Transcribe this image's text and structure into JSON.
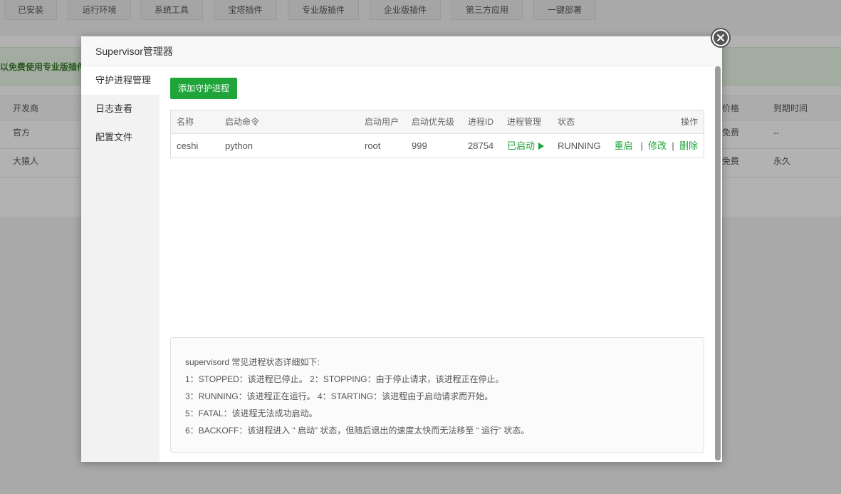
{
  "background": {
    "tabs": [
      "已安装",
      "运行环境",
      "系统工具",
      "宝塔插件",
      "专业版插件",
      "企业版插件",
      "第三方应用",
      "一键部署"
    ],
    "notice": "以免费使用专业版插件",
    "table_headers": {
      "developer": "开发商",
      "price": "价格",
      "expire": "到期时间"
    },
    "rows": [
      {
        "developer": "官方",
        "price": "免费",
        "expire": "--"
      },
      {
        "developer": "大猿人",
        "price": "免费",
        "expire": "永久"
      }
    ]
  },
  "modal": {
    "title": "Supervisor管理器",
    "close_icon": "close-icon"
  },
  "sidebar": {
    "items": [
      {
        "label": "守护进程管理",
        "active": true
      },
      {
        "label": "日志查看",
        "active": false
      },
      {
        "label": "配置文件",
        "active": false
      }
    ]
  },
  "toolbar": {
    "add_label": "添加守护进程"
  },
  "table": {
    "headers": {
      "name": "名称",
      "command": "启动命令",
      "user": "启动用户",
      "priority": "启动优先级",
      "pid": "进程ID",
      "manage": "进程管理",
      "status": "状态",
      "actions": "操作"
    },
    "rows": [
      {
        "name": "ceshi",
        "command": "python",
        "user": "root",
        "priority": "999",
        "pid": "28754",
        "manage": "已启动",
        "status": "RUNNING",
        "restart": "重启",
        "edit": "修改",
        "delete": "删除"
      }
    ]
  },
  "help": {
    "lines": [
      "supervisord 常见进程状态详细如下:",
      "1：STOPPED：该进程已停止。      2：STOPPING：由于停止请求，该进程正在停止。",
      "3：RUNNING：该进程正在运行。  4：STARTING：该进程由于启动请求而开始。",
      "5：FATAL：该进程无法成功启动。",
      "6：BACKOFF：该进程进入 “ 启动” 状态，但随后退出的速度太快而无法移至 “ 运行” 状态。"
    ]
  },
  "colors": {
    "accent": "#20a53a",
    "text": "#333333"
  }
}
